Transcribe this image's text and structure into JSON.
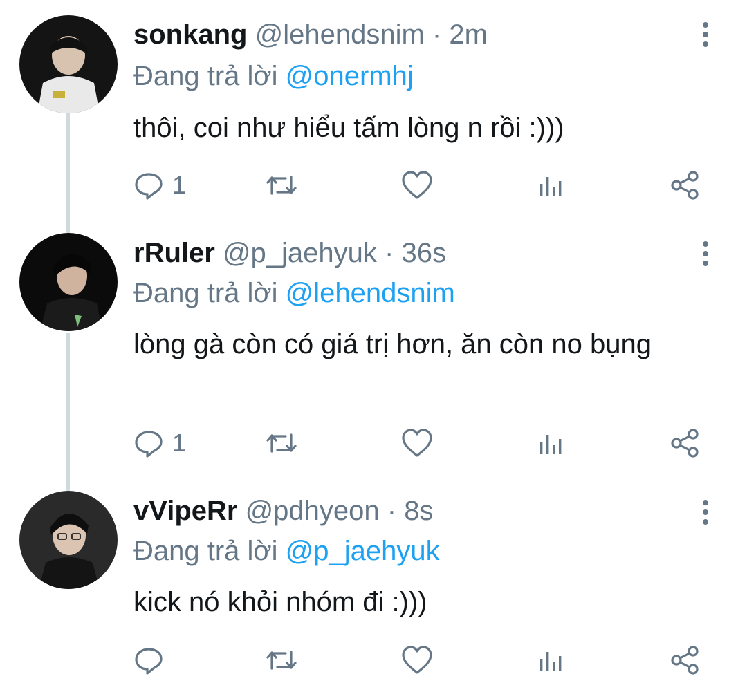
{
  "tweets": [
    {
      "display_name": "sonkang",
      "handle": "@lehendsnim",
      "separator": "·",
      "time": "2m",
      "replying_prefix": "Đang trả lời",
      "replying_to": "@onermhj",
      "text": "thôi, coi như hiểu tấm lòng n rồi :)))",
      "reply_count": "1",
      "avatar_bg": "#1a1a1a"
    },
    {
      "display_name": "rRuler",
      "handle": "@p_jaehyuk",
      "separator": "·",
      "time": "36s",
      "replying_prefix": "Đang trả lời",
      "replying_to": "@lehendsnim",
      "text": "lòng gà còn có giá trị hơn, ăn còn no bụng",
      "reply_count": "1",
      "avatar_bg": "#0d0d0d"
    },
    {
      "display_name": "vVipeRr",
      "handle": "@pdhyeon",
      "separator": "·",
      "time": "8s",
      "replying_prefix": "Đang trả lời",
      "replying_to": "@p_jaehyuk",
      "text": "kick nó khỏi nhóm đi :)))",
      "reply_count": "",
      "avatar_bg": "#2a2a2a"
    }
  ],
  "colors": {
    "name": "#14171a",
    "secondary": "#657786",
    "mention": "#1da1f2",
    "thread_line": "#cfd9de"
  },
  "icons": {
    "reply": "reply-icon",
    "retweet": "retweet-icon",
    "like": "heart-icon",
    "analytics": "analytics-icon",
    "share": "share-icon",
    "more": "more-vertical-icon"
  }
}
